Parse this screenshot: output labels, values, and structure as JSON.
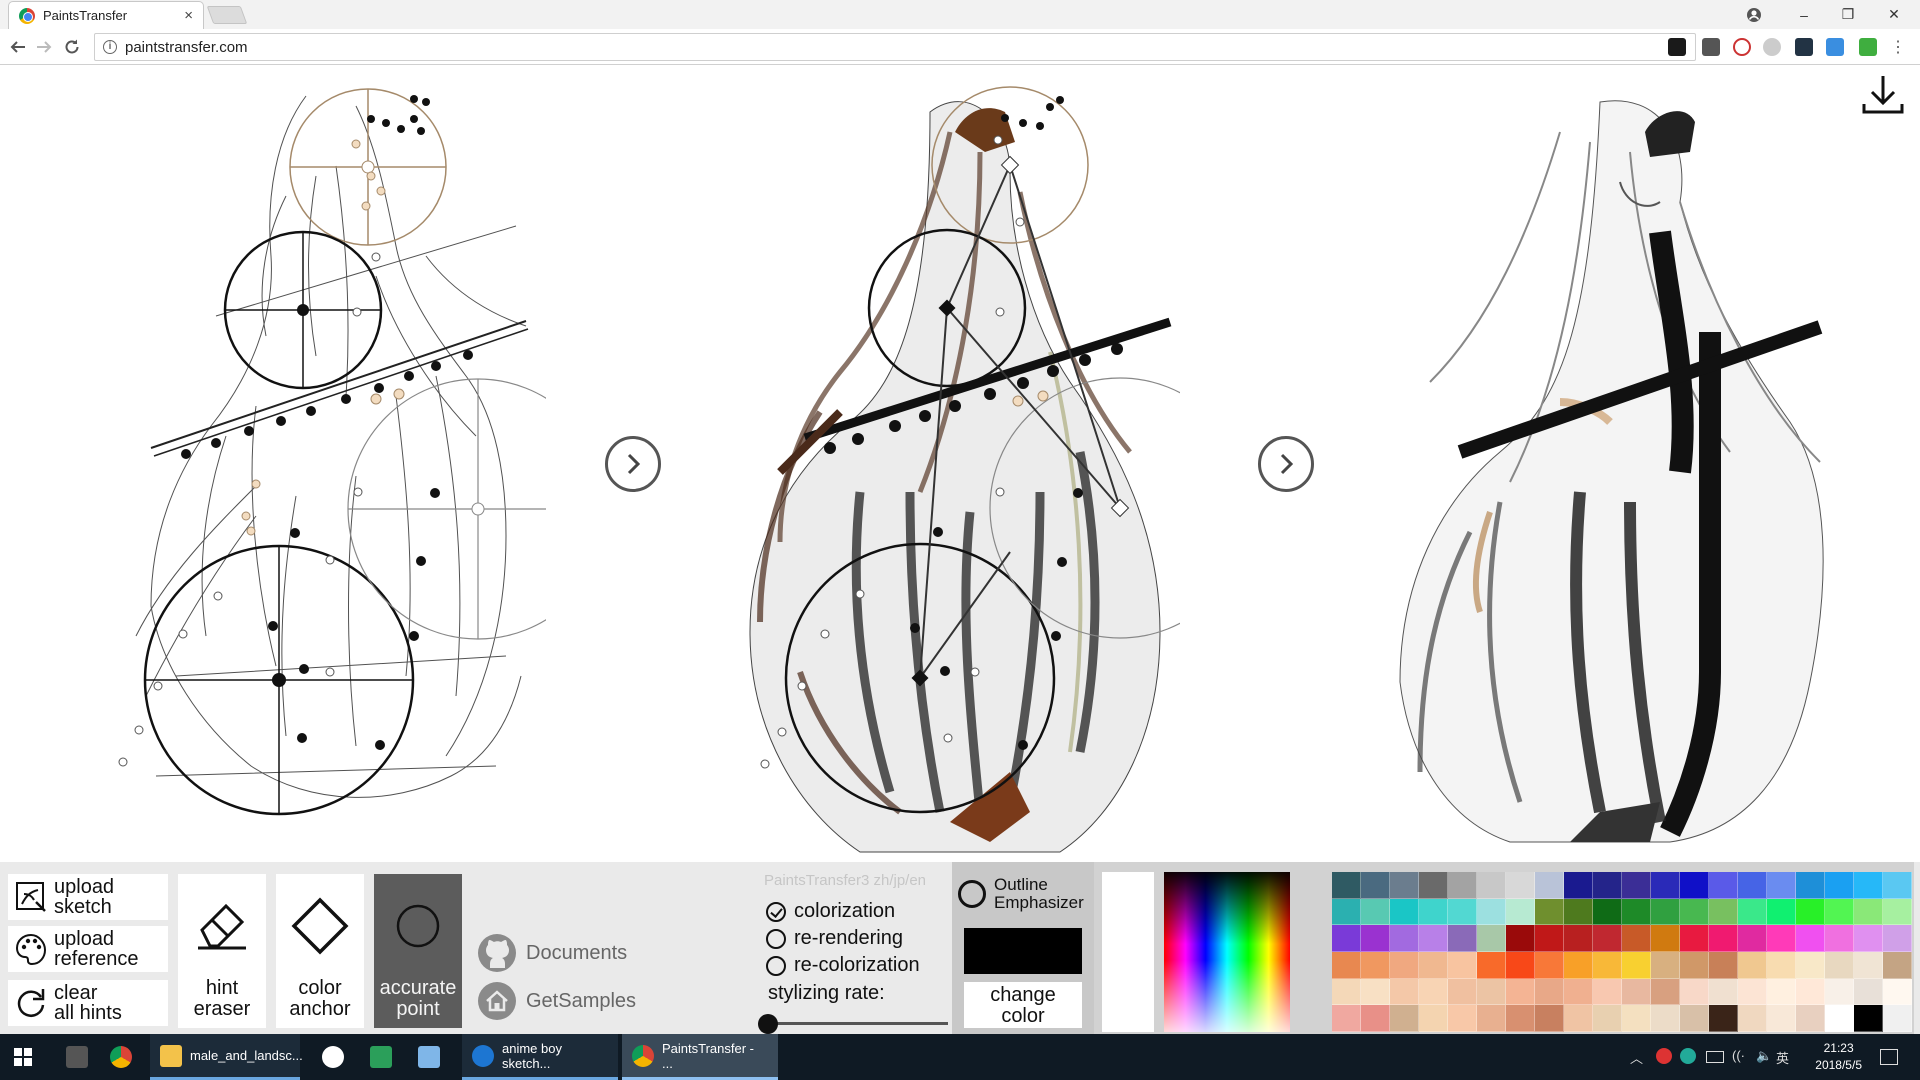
{
  "browser": {
    "tab_title": "PaintsTransfer",
    "tab_close": "×",
    "url": "paintstransfer.com",
    "win_min": "–",
    "win_restore": "❐",
    "win_close": "✕"
  },
  "panel": {
    "upload_sketch": [
      "upload",
      "sketch"
    ],
    "upload_reference": [
      "upload",
      "reference"
    ],
    "clear_all_hints": [
      "clear",
      "all hints"
    ],
    "tools": [
      {
        "l1": "hint",
        "l2": "eraser"
      },
      {
        "l1": "color",
        "l2": "anchor"
      },
      {
        "l1": "accurate",
        "l2": "point"
      }
    ],
    "documents": "Documents",
    "get_samples": "GetSamples",
    "brand": "PaintsTransfer3 zh/jp/en",
    "options": [
      "colorization",
      "re-rendering",
      "re-colorization"
    ],
    "selected_option": "colorization",
    "stylizing_rate_label": "stylizing rate:",
    "stylizing_rate": 0,
    "outline_label": [
      "Outline",
      "Emphasizer"
    ],
    "change_color": [
      "change",
      "color"
    ],
    "current_color": "#000000"
  },
  "palette": [
    "#2f5a63",
    "#4a6a80",
    "#6b7d8e",
    "#6a6a6a",
    "#a3a3a3",
    "#c8c8c8",
    "#d8d8d8",
    "#b9c3d8",
    "#1a1a8f",
    "#24248a",
    "#3b2e96",
    "#2a2ab8",
    "#1010c8",
    "#5a5ae8",
    "#4664e6",
    "#6a8cf0",
    "#1e8fd8",
    "#1aa0f2",
    "#26b8f8",
    "#5ac8f2",
    "#2bb0b0",
    "#58c9b2",
    "#1ac6c6",
    "#3fd4cc",
    "#52d8d2",
    "#9ce0e0",
    "#b7ead2",
    "#6f8f2e",
    "#4e7a1e",
    "#0f6b16",
    "#1e8a28",
    "#30a040",
    "#48b850",
    "#78c060",
    "#3ae88a",
    "#10f070",
    "#28f028",
    "#52f552",
    "#8ae878",
    "#a6f0a0",
    "#7a3ad8",
    "#9a32d0",
    "#a26ae0",
    "#b880e8",
    "#8a6ab8",
    "#a8c8a8",
    "#9a0a0a",
    "#c01818",
    "#b82020",
    "#c02830",
    "#c85a28",
    "#d07a10",
    "#e81a40",
    "#f01a70",
    "#e02aa0",
    "#ff3ab8",
    "#f050f0",
    "#f070e0",
    "#e090f0",
    "#d0a0e8",
    "#e88850",
    "#f09860",
    "#f0a880",
    "#f0b890",
    "#f8c4a0",
    "#f86a2a",
    "#f84818",
    "#f87838",
    "#f8a028",
    "#f8b838",
    "#f8d030",
    "#d8b080",
    "#d09868",
    "#c88058",
    "#f0c890",
    "#f8dcb0",
    "#f8e8c8",
    "#e8d8c0",
    "#f0e4d4",
    "#c4a484",
    "#f4d8b8",
    "#f8e0c4",
    "#f4c8a8",
    "#f8d4b4",
    "#f0c0a0",
    "#ecc4a4",
    "#f4b494",
    "#e8a888",
    "#f0b090",
    "#f8c8b0",
    "#e8b8a0",
    "#d8a080",
    "#f8d8c8",
    "#f0e0d0",
    "#fce4d4",
    "#fff0e0",
    "#ffe8d8",
    "#f8f0e8",
    "#e8e0d8",
    "#fff8f0",
    "#f0a8a0",
    "#e89088",
    "#d0b090",
    "#f4d4b0",
    "#f8c8a8",
    "#e8b090",
    "#d89070",
    "#c88060",
    "#f0c4a4",
    "#e8d0b0",
    "#f4e0c0",
    "#ecdcc8",
    "#d8c0a8",
    "#3a2418",
    "#f0d8c0",
    "#f8e8d8",
    "#e8d0c0",
    "#ffffff",
    "#000000",
    "#f0f0f0"
  ],
  "taskbar": {
    "items": [
      "male_and_landsc...",
      "anime boy sketch...",
      "PaintsTransfer - ..."
    ],
    "time": "21:23",
    "date": "2018/5/5",
    "ime": "英"
  }
}
